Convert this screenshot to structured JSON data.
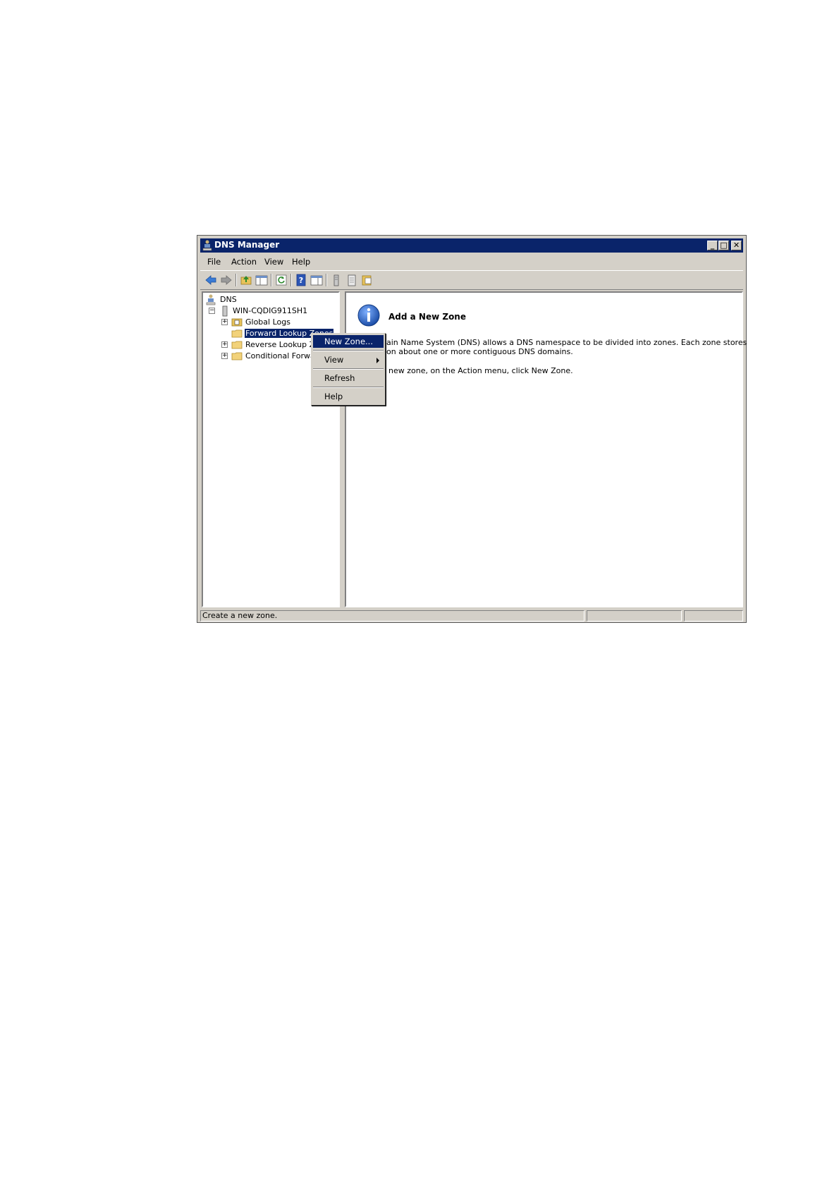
{
  "window": {
    "title": "DNS Manager",
    "minimize": "_",
    "maximize": "□",
    "close": "✕"
  },
  "menubar": {
    "file": "File",
    "action": "Action",
    "view": "View",
    "help": "Help"
  },
  "toolbar": {
    "icons": [
      "back-icon",
      "forward-icon",
      "up-icon",
      "show-hide-tree-icon",
      "refresh-icon",
      "help-icon",
      "properties-icon",
      "server-icon",
      "list-icon",
      "export-icon"
    ]
  },
  "tree": {
    "root": "DNS",
    "server": "WIN-CQDIG911SH1",
    "items": [
      {
        "label": "Global Logs"
      },
      {
        "label": "Forward Lookup Zones"
      },
      {
        "label": "Reverse Lookup Zones"
      },
      {
        "label": "Conditional Forwarders"
      }
    ]
  },
  "content": {
    "heading": "Add a New Zone",
    "para1_line1": "ain Name System (DNS) allows a DNS namespace to be divided into zones. Each zone stores",
    "para1_line2": "on about one or more contiguous DNS domains.",
    "para2": "new zone, on the Action menu, click New Zone."
  },
  "context_menu": {
    "new_zone": "New Zone...",
    "view": "View",
    "refresh": "Refresh",
    "help": "Help"
  },
  "statusbar": {
    "text": "Create a new zone."
  },
  "colors": {
    "titlebar": "#0a246a",
    "face": "#d4d0c8",
    "selection": "#0a246a"
  }
}
